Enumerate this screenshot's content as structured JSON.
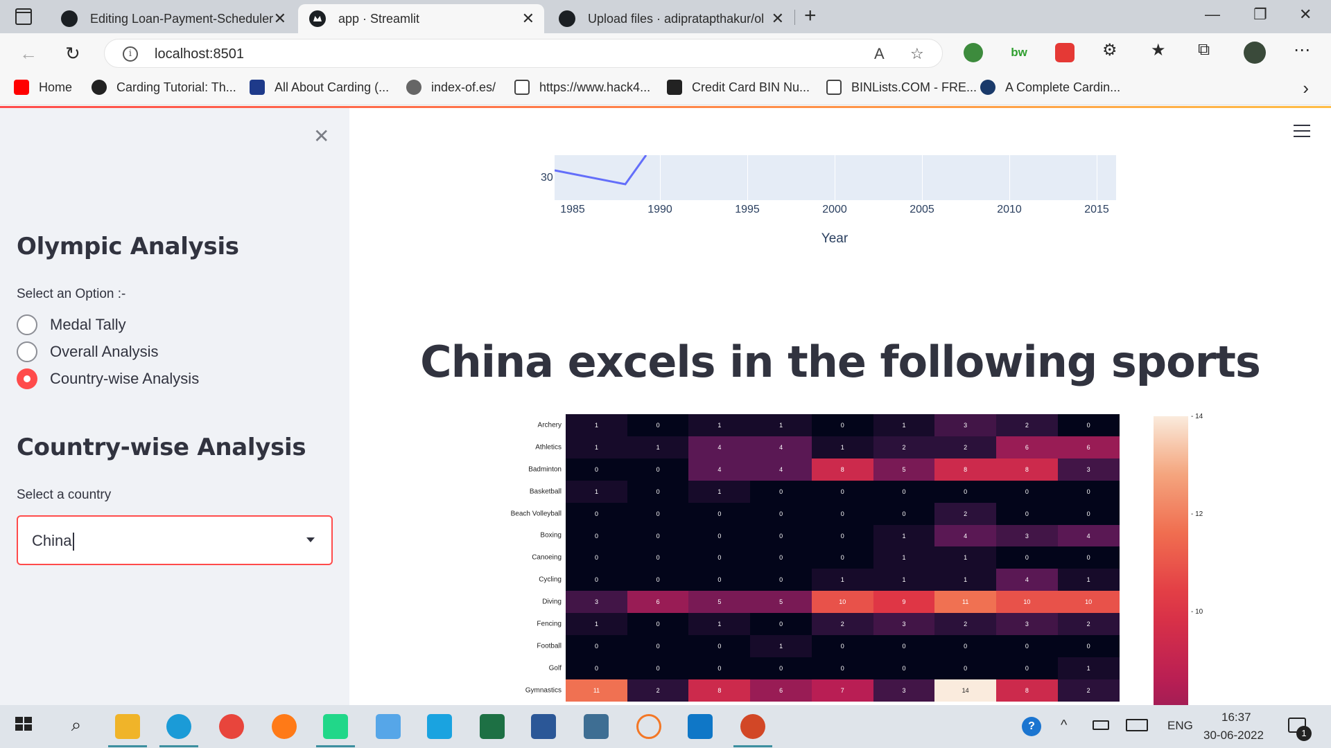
{
  "browser": {
    "tabs": [
      {
        "title": "Editing Loan-Payment-Scheduler",
        "icon": "github-icon"
      },
      {
        "title": "app · Streamlit",
        "icon": "streamlit-icon"
      },
      {
        "title": "Upload files · adipratapthakur/ol",
        "icon": "github-icon"
      }
    ],
    "url": "localhost:8501",
    "bookmarks": [
      "Home",
      "Carding Tutorial: Th...",
      "All About Carding (...",
      "index-of.es/",
      "https://www.hack4...",
      "Credit Card BIN Nu...",
      "BINLists.COM - FRE...",
      "A Complete Cardin..."
    ]
  },
  "sidebar": {
    "title": "Olympic Analysis",
    "option_label": "Select an Option :-",
    "options": [
      "Medal Tally",
      "Overall Analysis",
      "Country-wise Analysis"
    ],
    "selected_option": "Country-wise Analysis",
    "section_title": "Country-wise Analysis",
    "country_label": "Select a country",
    "country_value": "China"
  },
  "line_chart": {
    "x_ticks": [
      "1985",
      "1990",
      "1995",
      "2000",
      "2005",
      "2010",
      "2015"
    ],
    "y_tick": "30",
    "x_title": "Year",
    "line_color": "#636efa"
  },
  "main": {
    "heading": "China excels in the following sports"
  },
  "chart_data": {
    "type": "heatmap",
    "rows": [
      "Archery",
      "Athletics",
      "Badminton",
      "Basketball",
      "Beach Volleyball",
      "Boxing",
      "Canoeing",
      "Cycling",
      "Diving",
      "Fencing",
      "Football",
      "Golf",
      "Gymnastics"
    ],
    "values": [
      [
        1,
        0,
        1,
        1,
        0,
        1,
        3,
        2,
        0
      ],
      [
        1,
        1,
        4,
        4,
        1,
        2,
        2,
        6,
        6
      ],
      [
        0,
        0,
        4,
        4,
        8,
        5,
        8,
        8,
        3
      ],
      [
        1,
        0,
        1,
        0,
        0,
        0,
        0,
        0,
        0
      ],
      [
        0,
        0,
        0,
        0,
        0,
        0,
        2,
        0,
        0
      ],
      [
        0,
        0,
        0,
        0,
        0,
        1,
        4,
        3,
        4
      ],
      [
        0,
        0,
        0,
        0,
        0,
        1,
        1,
        0,
        0
      ],
      [
        0,
        0,
        0,
        0,
        1,
        1,
        1,
        4,
        1
      ],
      [
        3,
        6,
        5,
        5,
        10,
        9,
        11,
        10,
        10
      ],
      [
        1,
        0,
        1,
        0,
        2,
        3,
        2,
        3,
        2
      ],
      [
        0,
        0,
        0,
        1,
        0,
        0,
        0,
        0,
        0
      ],
      [
        0,
        0,
        0,
        0,
        0,
        0,
        0,
        0,
        1
      ],
      [
        11,
        2,
        8,
        6,
        7,
        3,
        14,
        8,
        2
      ]
    ],
    "colorbar_ticks": [
      "14",
      "12",
      "10"
    ],
    "vmax": 14
  },
  "taskbar": {
    "language": "ENG",
    "time": "16:37",
    "date": "30-06-2022",
    "notification_count": "1"
  }
}
